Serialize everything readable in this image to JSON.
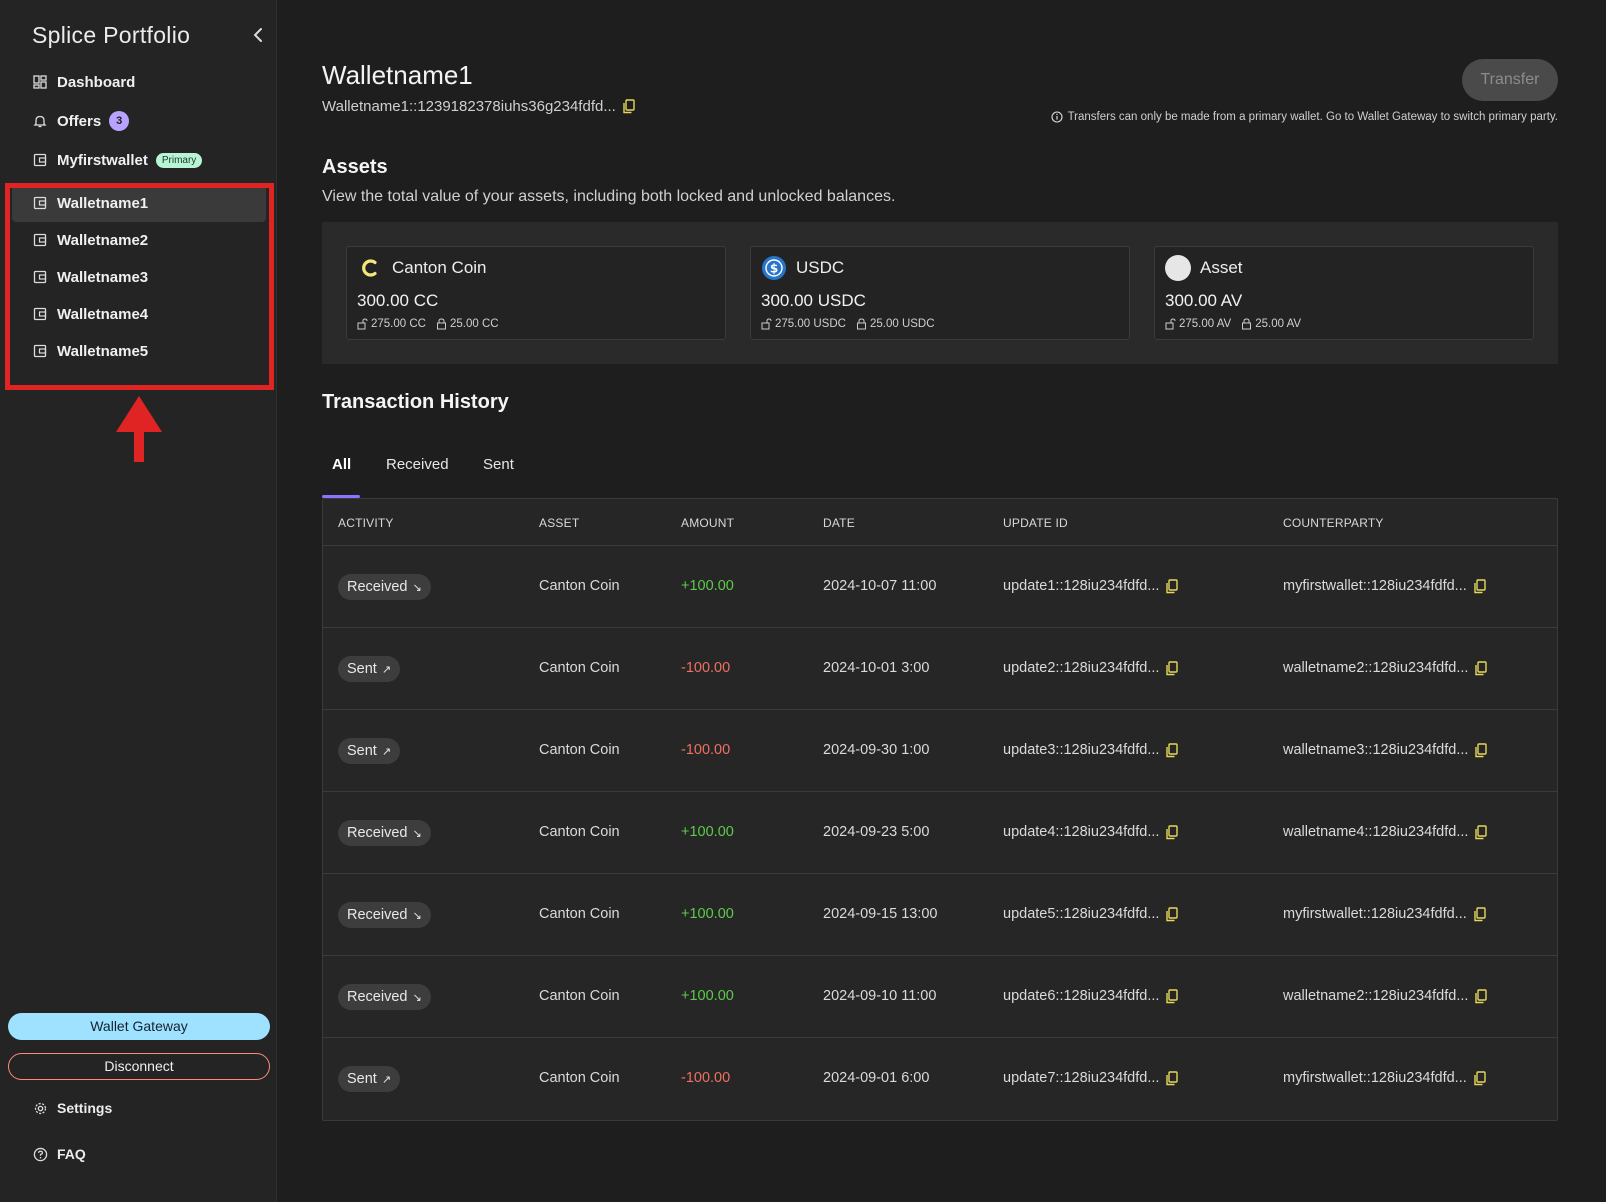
{
  "sidebar": {
    "brand": "Splice Portfolio",
    "nav": [
      {
        "label": "Dashboard",
        "icon": "dashboard-icon"
      },
      {
        "label": "Offers",
        "icon": "bell-icon",
        "count": "3"
      },
      {
        "label": "Myfirstwallet",
        "icon": "wallet-icon",
        "badge": "Primary"
      },
      {
        "label": "Walletname1",
        "icon": "wallet-icon",
        "active": true
      },
      {
        "label": "Walletname2",
        "icon": "wallet-icon"
      },
      {
        "label": "Walletname3",
        "icon": "wallet-icon"
      },
      {
        "label": "Walletname4",
        "icon": "wallet-icon"
      },
      {
        "label": "Walletname5",
        "icon": "wallet-icon"
      }
    ],
    "gateway_label": "Wallet Gateway",
    "disconnect_label": "Disconnect",
    "settings_label": "Settings",
    "faq_label": "FAQ"
  },
  "wallet": {
    "title": "Walletname1",
    "address": "Walletname1::1239182378iuhs36g234fdfd...",
    "transfer_label": "Transfer",
    "transfer_note": "Transfers can only be made from a primary wallet. Go to Wallet Gateway to switch primary party."
  },
  "assets": {
    "title": "Assets",
    "description": "View the total value of your assets, including both locked and unlocked balances.",
    "cards": [
      {
        "name": "Canton Coin",
        "logo": "canton-coin-logo",
        "total": "300.00 CC",
        "unlocked": "275.00 CC",
        "locked": "25.00 CC"
      },
      {
        "name": "USDC",
        "logo": "usdc-logo",
        "total": "300.00 USDC",
        "unlocked": "275.00 USDC",
        "locked": "25.00 USDC"
      },
      {
        "name": "Asset",
        "logo": "generic-asset-logo",
        "total": "300.00 AV",
        "unlocked": "275.00 AV",
        "locked": "25.00 AV"
      }
    ]
  },
  "history": {
    "title": "Transaction History",
    "tabs": [
      "All",
      "Received",
      "Sent"
    ],
    "active_tab": "All",
    "columns": [
      "ACTIVITY",
      "ASSET",
      "AMOUNT",
      "DATE",
      "UPDATE ID",
      "COUNTERPARTY"
    ],
    "rows": [
      {
        "activity": "Received",
        "dir": "↘",
        "asset": "Canton Coin",
        "amount": "+100.00",
        "positive": true,
        "date": "2024-10-07 11:00",
        "update_id": "update1::128iu234fdfd...",
        "counterparty": "myfirstwallet::128iu234fdfd..."
      },
      {
        "activity": "Sent",
        "dir": "↗",
        "asset": "Canton Coin",
        "amount": "-100.00",
        "positive": false,
        "date": "2024-10-01 3:00",
        "update_id": "update2::128iu234fdfd...",
        "counterparty": "walletname2::128iu234fdfd..."
      },
      {
        "activity": "Sent",
        "dir": "↗",
        "asset": "Canton Coin",
        "amount": "-100.00",
        "positive": false,
        "date": "2024-09-30 1:00",
        "update_id": "update3::128iu234fdfd...",
        "counterparty": "walletname3::128iu234fdfd..."
      },
      {
        "activity": "Received",
        "dir": "↘",
        "asset": "Canton Coin",
        "amount": "+100.00",
        "positive": true,
        "date": "2024-09-23 5:00",
        "update_id": "update4::128iu234fdfd...",
        "counterparty": "walletname4::128iu234fdfd..."
      },
      {
        "activity": "Received",
        "dir": "↘",
        "asset": "Canton Coin",
        "amount": "+100.00",
        "positive": true,
        "date": "2024-09-15 13:00",
        "update_id": "update5::128iu234fdfd...",
        "counterparty": "myfirstwallet::128iu234fdfd..."
      },
      {
        "activity": "Received",
        "dir": "↘",
        "asset": "Canton Coin",
        "amount": "+100.00",
        "positive": true,
        "date": "2024-09-10 11:00",
        "update_id": "update6::128iu234fdfd...",
        "counterparty": "walletname2::128iu234fdfd..."
      },
      {
        "activity": "Sent",
        "dir": "↗",
        "asset": "Canton Coin",
        "amount": "-100.00",
        "positive": false,
        "date": "2024-09-01 6:00",
        "update_id": "update7::128iu234fdfd...",
        "counterparty": "myfirstwallet::128iu234fdfd..."
      }
    ]
  },
  "colors": {
    "accent": "#8a73ff",
    "positive": "#5ccb4a",
    "negative": "#ef7063",
    "highlight": "#e02424"
  }
}
